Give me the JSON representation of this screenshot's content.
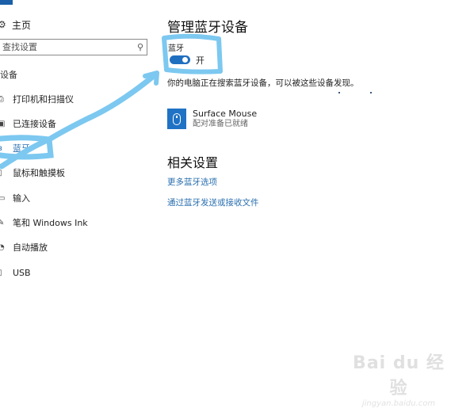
{
  "sidebar": {
    "home": {
      "label": "主页",
      "icon": "gear-icon"
    },
    "search": {
      "placeholder": "查找设置",
      "icon": "search-icon"
    },
    "section_title": "设备",
    "items": [
      {
        "label": "打印机和扫描仪",
        "icon": "printer-icon"
      },
      {
        "label": "已连接设备",
        "icon": "connected-devices-icon"
      },
      {
        "label": "蓝牙",
        "icon": "bluetooth-icon",
        "active": true
      },
      {
        "label": "鼠标和触摸板",
        "icon": "mouse-icon"
      },
      {
        "label": "输入",
        "icon": "keyboard-icon"
      },
      {
        "label": "笔和 Windows Ink",
        "icon": "pen-icon"
      },
      {
        "label": "自动播放",
        "icon": "autoplay-icon"
      },
      {
        "label": "USB",
        "icon": "usb-icon"
      }
    ]
  },
  "main": {
    "title": "管理蓝牙设备",
    "bluetooth_label": "蓝牙",
    "toggle_state": "开",
    "toggle_on": true,
    "description": "你的电脑正在搜索蓝牙设备，可以被这些设备发现。",
    "devices": [
      {
        "name": "Surface Mouse",
        "status": "配对准备已就绪",
        "icon": "mouse-icon"
      }
    ],
    "related_title": "相关设置",
    "links": [
      "更多蓝牙选项",
      "通过蓝牙发送或接收文件"
    ]
  },
  "colors": {
    "accent": "#1f6fc0",
    "link": "#2a6fb0",
    "annotation": "#7cc8f0"
  },
  "watermark": {
    "brand": "Bai du 经验",
    "url": "jingyan.baidu.com"
  }
}
